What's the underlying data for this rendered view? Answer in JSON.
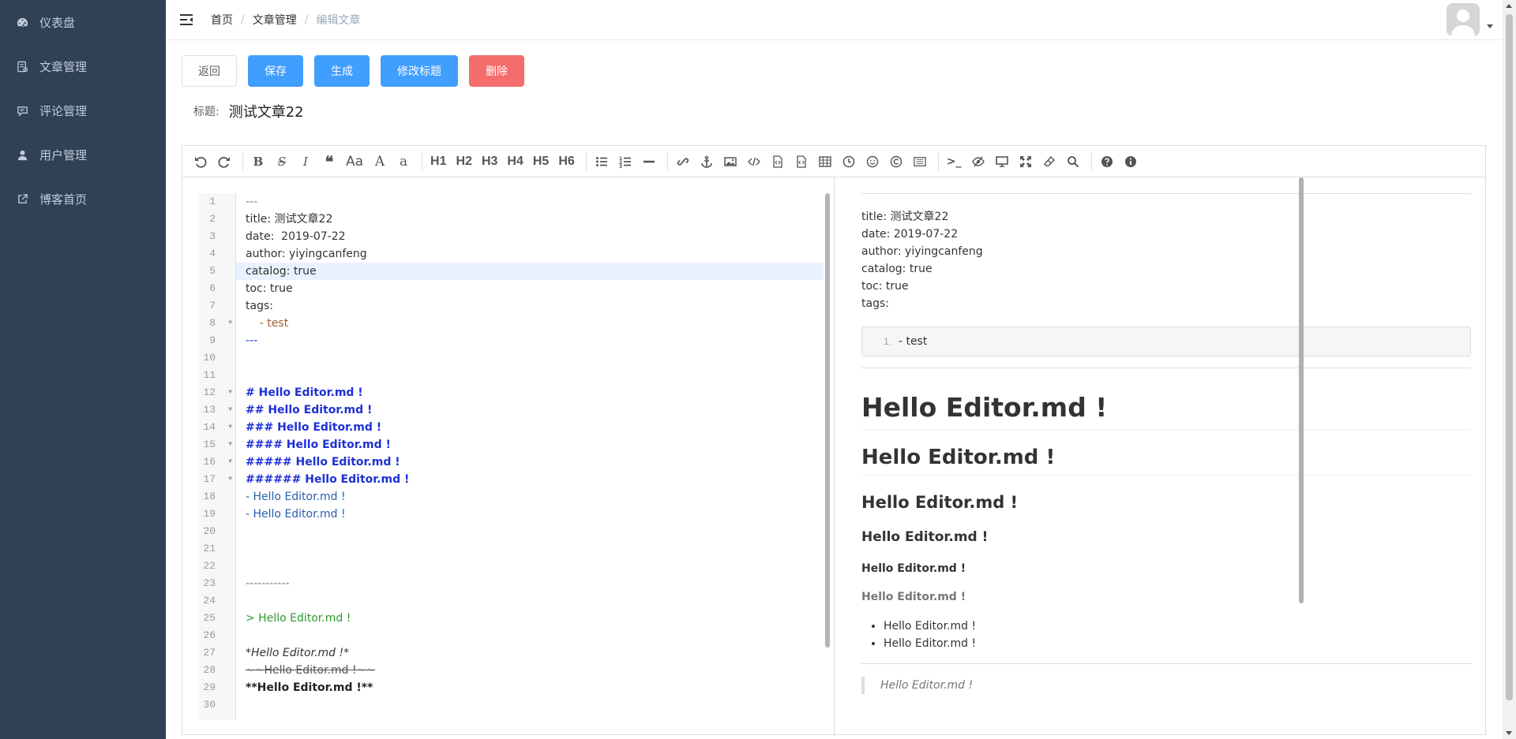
{
  "sidebar": {
    "items": [
      {
        "label": "仪表盘",
        "icon": "dashboard-icon"
      },
      {
        "label": "文章管理",
        "icon": "article-icon"
      },
      {
        "label": "评论管理",
        "icon": "comment-icon"
      },
      {
        "label": "用户管理",
        "icon": "user-icon"
      },
      {
        "label": "博客首页",
        "icon": "external-link-icon"
      }
    ]
  },
  "breadcrumb": {
    "home": "首页",
    "section": "文章管理",
    "current": "编辑文章",
    "separator": "/"
  },
  "actions": {
    "back": "返回",
    "save": "保存",
    "generate": "生成",
    "rename": "修改标题",
    "delete": "删除"
  },
  "title": {
    "label": "标题:",
    "value": "测试文章22"
  },
  "toolbar": {
    "headings": [
      "H1",
      "H2",
      "H3",
      "H4",
      "H5",
      "H6"
    ],
    "font_case_upper": "Aa",
    "font_upper": "A",
    "font_lower": "a"
  },
  "editor": {
    "line_numbers": [
      "1",
      "2",
      "3",
      "4",
      "5",
      "6",
      "7",
      "8",
      "9",
      "10",
      "11",
      "12",
      "13",
      "14",
      "15",
      "16",
      "17",
      "18",
      "19",
      "20",
      "21",
      "22",
      "23",
      "24",
      "25",
      "26",
      "27",
      "28",
      "29",
      "30"
    ],
    "lines": [
      "---",
      "title: 测试文章22",
      "date:  2019-07-22",
      "author: yiyingcanfeng",
      "catalog: true",
      "toc: true",
      "tags:",
      "    - test",
      "---",
      "",
      "",
      "# Hello Editor.md !",
      "## Hello Editor.md !",
      "### Hello Editor.md !",
      "#### Hello Editor.md !",
      "##### Hello Editor.md !",
      "###### Hello Editor.md !",
      "- Hello Editor.md !",
      "- Hello Editor.md !",
      "",
      "",
      "",
      "-----------",
      "",
      "> Hello Editor.md !",
      "",
      "*Hello Editor.md !*",
      "~~Hello Editor.md !~~",
      "**Hello Editor.md !**",
      ""
    ]
  },
  "preview": {
    "meta": [
      "title: 测试文章22",
      "date: 2019-07-22",
      "author: yiyingcanfeng",
      "catalog: true",
      "toc: true",
      "tags:"
    ],
    "code_num": "1.",
    "code_line": "- test",
    "h1": "Hello Editor.md !",
    "h2": "Hello Editor.md !",
    "h3": "Hello Editor.md !",
    "h4": "Hello Editor.md !",
    "h5": "Hello Editor.md !",
    "h6": "Hello Editor.md !",
    "list": [
      "Hello Editor.md !",
      "Hello Editor.md !"
    ],
    "quote": "Hello Editor.md !"
  },
  "colors": {
    "sidebar_bg": "#304156",
    "primary": "#409eff",
    "danger": "#f56c6c"
  }
}
